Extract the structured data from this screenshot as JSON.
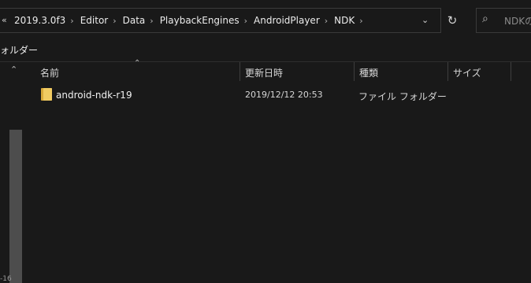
{
  "address_bar": {
    "overflow": "«",
    "crumbs": [
      "2019.3.0f3",
      "Editor",
      "Data",
      "PlaybackEngines",
      "AndroidPlayer",
      "NDK"
    ],
    "separator": "›",
    "dropdown": "⌄",
    "refresh": "↻"
  },
  "search": {
    "placeholder": "NDKの検索"
  },
  "nav_pane": {
    "folder_label": "ォルダー",
    "bottom_text": "-16"
  },
  "columns": {
    "name": "名前",
    "modified": "更新日時",
    "type": "種類",
    "size": "サイズ"
  },
  "files": [
    {
      "name": "android-ndk-r19",
      "modified": "2019/12/12 20:53",
      "type": "ファイル フォルダー",
      "size": ""
    }
  ],
  "colors": {
    "background": "#191919",
    "folder": "#f1cb62",
    "text": "#e6e6e6"
  }
}
